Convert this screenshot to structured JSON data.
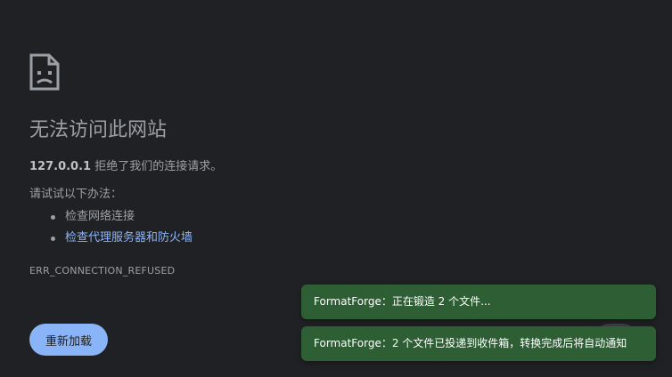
{
  "error": {
    "icon": "sad-page-icon",
    "title": "无法访问此网站",
    "host": "127.0.0.1",
    "summary_suffix": " 拒绝了我们的连接请求。",
    "try_label": "请试试以下办法：",
    "suggestions": [
      {
        "label": "检查网络连接",
        "is_link": false
      },
      {
        "label": "检查代理服务器和防火墙",
        "is_link": true
      }
    ],
    "code": "ERR_CONNECTION_REFUSED",
    "reload_label": "重新加载"
  },
  "toasts": [
    {
      "text": "FormatForge：正在锻造 2 个文件..."
    },
    {
      "text": "FormatForge：2 个文件已投递到收件箱，转换完成后将自动通知"
    }
  ],
  "colors": {
    "background": "#202124",
    "text": "#9aa0a6",
    "link": "#8ab4f8",
    "button": "#8ab4f8",
    "toast": "#2d5e34"
  }
}
